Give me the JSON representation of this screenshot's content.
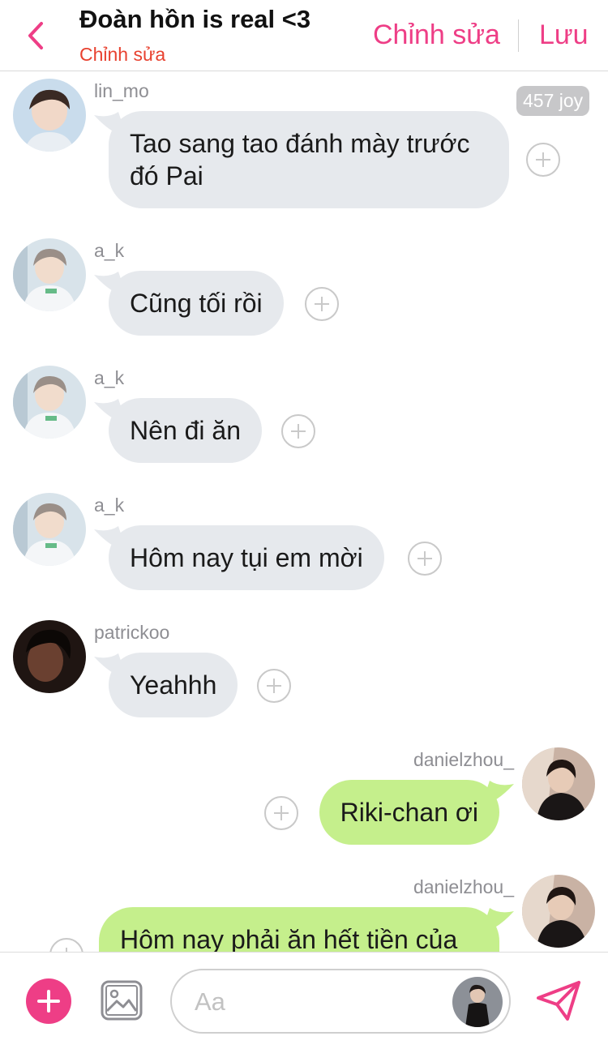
{
  "header": {
    "title": "Đoàn hồn is real <3",
    "subtitle": "Chỉnh sửa",
    "edit_label": "Chỉnh sửa",
    "save_label": "Lưu",
    "accent_color": "#ee3e86"
  },
  "messages": [
    {
      "user": "lin_mo",
      "text": "Tao sang tao đánh mày trước đó Pai",
      "direction": "incoming",
      "badge": "457 joy"
    },
    {
      "user": "a_k",
      "text": "Cũng tối rồi",
      "direction": "incoming"
    },
    {
      "user": "a_k",
      "text": "Nên đi ăn",
      "direction": "incoming"
    },
    {
      "user": "a_k",
      "text": "Hôm nay tụi em mời",
      "direction": "incoming"
    },
    {
      "user": "patrickoo",
      "text": "Yeahhh",
      "direction": "incoming"
    },
    {
      "user": "danielzhou_",
      "text": "Riki-chan ơi",
      "direction": "outgoing"
    },
    {
      "user": "danielzhou_",
      "text": "Hôm nay phải ăn hết tiền của",
      "direction": "outgoing"
    }
  ],
  "composer": {
    "placeholder": "Aa",
    "add_icon": "plus-icon",
    "image_icon": "image-icon",
    "send_icon": "send-icon"
  },
  "colors": {
    "incoming_bubble": "#e6e9ed",
    "outgoing_bubble": "#c5ef8c",
    "subtitle": "#e8412f"
  }
}
